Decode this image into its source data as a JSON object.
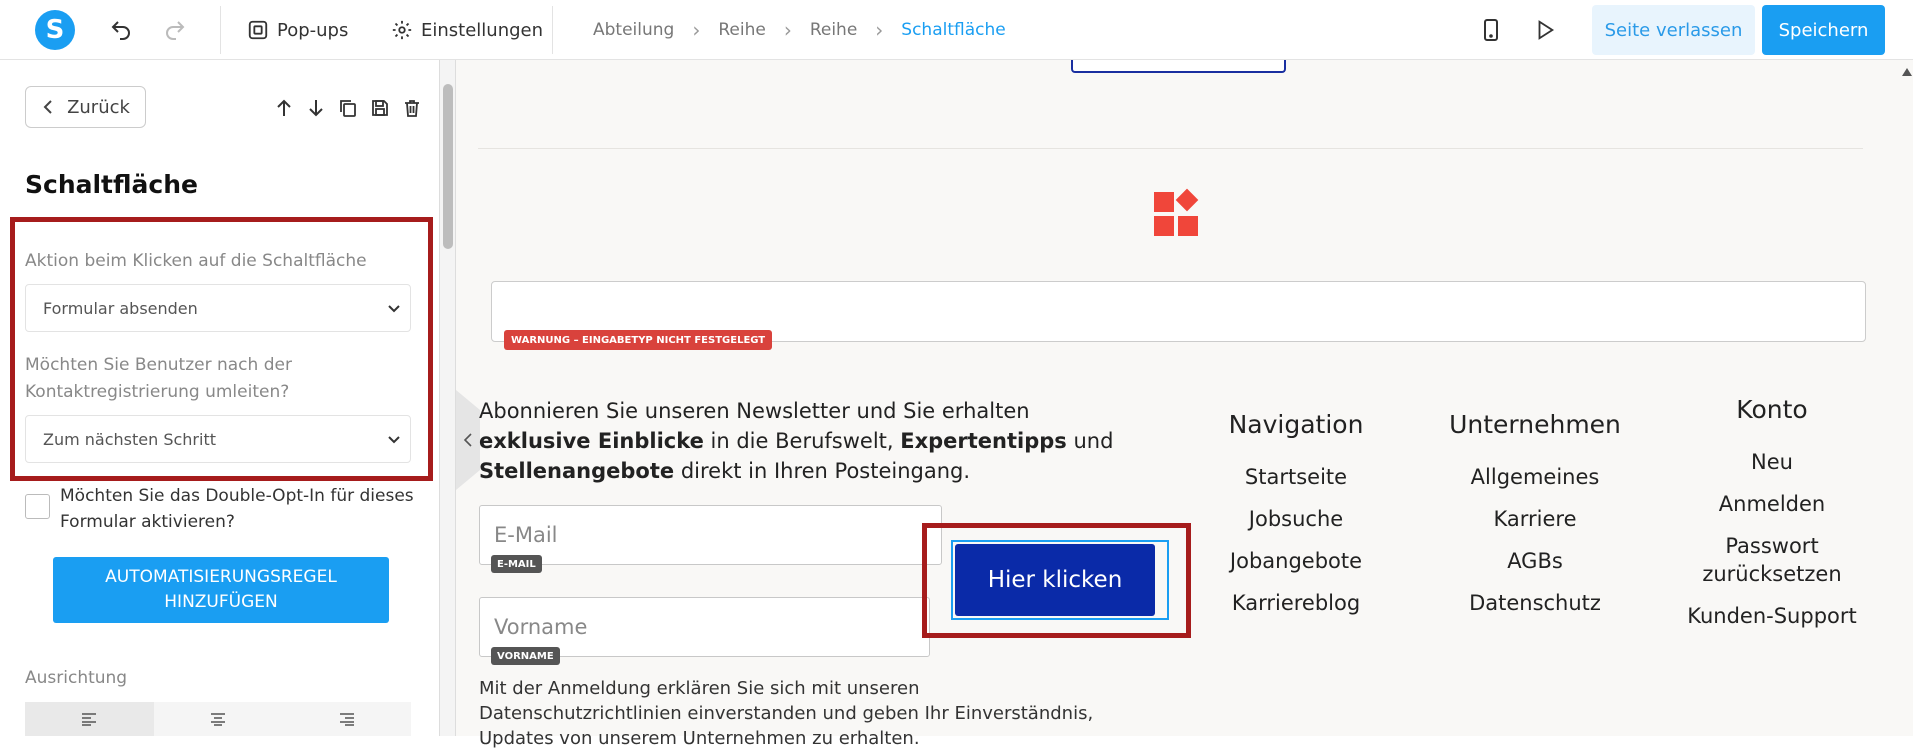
{
  "topbar": {
    "popups_label": "Pop-ups",
    "settings_label": "Einstellungen",
    "breadcrumbs": [
      "Abteilung",
      "Reihe",
      "Reihe",
      "Schaltfläche"
    ],
    "leave_label": "Seite verlassen",
    "save_label": "Speichern"
  },
  "sidebar": {
    "back_label": "Zurück",
    "title": "Schaltfläche",
    "action_label": "Aktion beim Klicken auf die Schaltfläche",
    "action_value": "Formular absenden",
    "redirect_label": "Möchten Sie Benutzer nach der Kontaktregistrierung umleiten?",
    "redirect_value": "Zum nächsten Schritt",
    "double_optin_label": "Möchten Sie das Double-Opt-In für dieses Formular aktivieren?",
    "automation_label": "AUTOMATISIERUNGSREGEL HINZUFÜGEN",
    "alignment_label": "Ausrichtung"
  },
  "canvas": {
    "warning_badge": "WARNUNG – EINGABETYP NICHT FESTGELEGT",
    "newsletter": {
      "p1": "Abonnieren Sie unseren Newsletter und Sie erhalten ",
      "b1": "exklusive Einblicke",
      "p2": " in die Berufswelt, ",
      "b2": "Expertentipps",
      "p3": " und ",
      "b3": "Stellenangebote",
      "p4": " direkt in Ihren Posteingang."
    },
    "email_placeholder": "E-Mail",
    "email_badge": "E-MAIL",
    "firstname_placeholder": "Vorname",
    "firstname_badge": "VORNAME",
    "cta_label": "Hier klicken",
    "privacy_text": "Mit der Anmeldung erklären Sie sich mit unseren Datenschutzrichtlinien einverstanden und geben Ihr Einverständnis, Updates von unserem Unternehmen zu erhalten.",
    "columns": [
      {
        "title": "Navigation",
        "links": [
          "Startseite",
          "Jobsuche",
          "Jobangebote",
          "Karriereblog"
        ]
      },
      {
        "title": "Unternehmen",
        "links": [
          "Allgemeines",
          "Karriere",
          "AGBs",
          "Datenschutz"
        ]
      },
      {
        "title": "Konto",
        "links": [
          "Neu",
          "Anmelden",
          "Passwort zurücksetzen",
          "Kunden-Support"
        ]
      }
    ]
  },
  "colors": {
    "accent": "#1a9ef2",
    "cta": "#0a2aa8",
    "highlight": "#a61c1c",
    "warning": "#d9423c"
  }
}
